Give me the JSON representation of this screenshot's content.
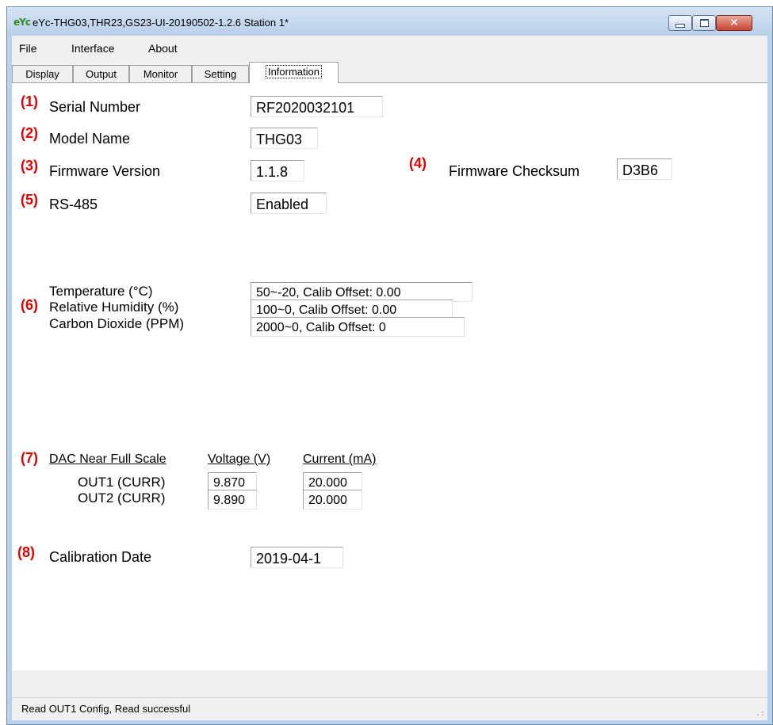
{
  "window": {
    "title": "eYc-THG03,THR23,GS23-UI-20190502-1.2.6  Station 1*",
    "logo_text": "eYc",
    "close_glyph": "✕"
  },
  "menu": {
    "file": "File",
    "interface": "Interface",
    "about": "About"
  },
  "tabs": {
    "display": "Display",
    "output": "Output",
    "monitor": "Monitor",
    "setting": "Setting",
    "information": "Information"
  },
  "info": {
    "serial": {
      "num": "(1)",
      "label": "Serial Number",
      "value": "RF2020032101"
    },
    "model": {
      "num": "(2)",
      "label": "Model Name",
      "value": "THG03"
    },
    "firmware": {
      "num": "(3)",
      "label": "Firmware Version",
      "value": "1.1.8"
    },
    "checksum": {
      "num": "(4)",
      "label": "Firmware Checksum",
      "value": "D3B6"
    },
    "rs485": {
      "num": "(5)",
      "label": "RS-485",
      "value": "Enabled"
    },
    "sensors": {
      "num": "(6)",
      "temperature": {
        "label": "Temperature (°C)",
        "value": "50~-20, Calib Offset: 0.00"
      },
      "humidity": {
        "label": "Relative Humidity (%)",
        "value": "100~0, Calib Offset: 0.00"
      },
      "co2": {
        "label": "Carbon Dioxide (PPM)",
        "value": "2000~0, Calib Offset: 0"
      }
    },
    "dac": {
      "num": "(7)",
      "header": "DAC Near Full Scale",
      "voltage_header": "Voltage (V)",
      "current_header": "Current (mA)",
      "out1": {
        "label": "OUT1 (CURR)",
        "voltage": "9.870",
        "current": "20.000"
      },
      "out2": {
        "label": "OUT2 (CURR)",
        "voltage": "9.890",
        "current": "20.000"
      }
    },
    "calibration": {
      "num": "(8)",
      "label": "Calibration Date",
      "value": "2019-04-1"
    }
  },
  "status": {
    "text": "Read OUT1 Config,   Read successful",
    "grip": ".:"
  },
  "colors": {
    "marker_red": "#e00000",
    "title_bar": "#b9d1ea"
  }
}
